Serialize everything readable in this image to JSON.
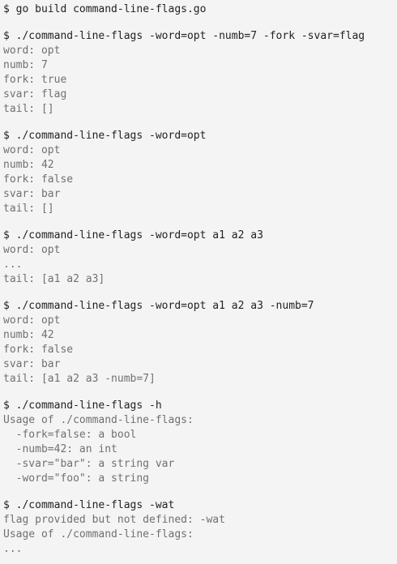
{
  "terminal": {
    "prompt": "$",
    "blocks": [
      {
        "command": "go build command-line-flags.go",
        "output": []
      },
      {
        "command": "./command-line-flags -word=opt -numb=7 -fork -svar=flag",
        "output": [
          "word: opt",
          "numb: 7",
          "fork: true",
          "svar: flag",
          "tail: []"
        ]
      },
      {
        "command": "./command-line-flags -word=opt",
        "output": [
          "word: opt",
          "numb: 42",
          "fork: false",
          "svar: bar",
          "tail: []"
        ]
      },
      {
        "command": "./command-line-flags -word=opt a1 a2 a3",
        "output": [
          "word: opt",
          "...",
          "tail: [a1 a2 a3]"
        ]
      },
      {
        "command": "./command-line-flags -word=opt a1 a2 a3 -numb=7",
        "output": [
          "word: opt",
          "numb: 42",
          "fork: false",
          "svar: bar",
          "tail: [a1 a2 a3 -numb=7]"
        ]
      },
      {
        "command": "./command-line-flags -h",
        "output": [
          "Usage of ./command-line-flags:",
          "  -fork=false: a bool",
          "  -numb=42: an int",
          "  -svar=\"bar\": a string var",
          "  -word=\"foo\": a string"
        ]
      },
      {
        "command": "./command-line-flags -wat",
        "output": [
          "flag provided but not defined: -wat",
          "Usage of ./command-line-flags:",
          "..."
        ]
      }
    ]
  }
}
